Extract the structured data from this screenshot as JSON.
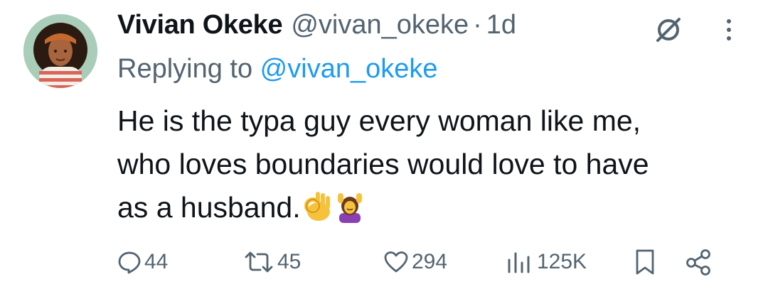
{
  "tweet": {
    "author_name": "Vivian Okeke",
    "author_handle": "@vivan_okeke",
    "separator": "·",
    "time": "1d",
    "reply_prefix": "Replying to ",
    "reply_to": "@vivan_okeke",
    "text_line1": "He is the typa guy every woman like me,",
    "text_line2": "who loves boundaries would love to have",
    "text_line3": "as a husband.",
    "emojis": [
      "ok-hand-emoji",
      "woman-getting-massage-emoji"
    ]
  },
  "actions": {
    "replies": "44",
    "reposts": "45",
    "likes": "294",
    "views": "125K"
  },
  "colors": {
    "text": "#0f1419",
    "secondary": "#536471",
    "link": "#1d9bf0"
  }
}
